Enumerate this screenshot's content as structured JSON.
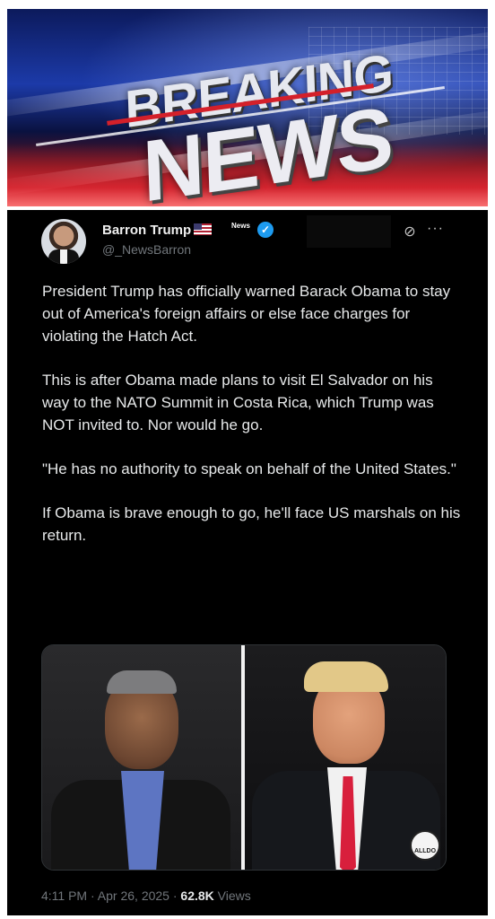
{
  "banner": {
    "line1": "BREAKING",
    "line2": "NEWS"
  },
  "tweet": {
    "author_name": "Barron Trump",
    "badge_text": "News",
    "verified_mark": "✓",
    "handle": "@_NewsBarron",
    "paragraphs": [
      "President Trump has officially warned Barack Obama to stay out of America's foreign affairs or else face charges for violating the Hatch Act.",
      "This is after Obama made plans to visit El Salvador on his way to the NATO Summit in Costa Rica, which Trump was NOT invited to. Nor would he go.",
      "\"He has no authority to speak on behalf of the United States.\"",
      "If Obama is brave enough to go, he'll face US marshals on his return."
    ],
    "media": {
      "watermark": "ALLDO"
    },
    "time": "4:11 PM",
    "separator": "·",
    "date": "Apr 26, 2025",
    "views_count": "62.8K",
    "views_label": "Views"
  },
  "icons": {
    "grok": "grok-icon",
    "more": "more-icon",
    "verified": "verified-badge-icon",
    "flag": "us-flag-icon"
  },
  "colors": {
    "background": "#000000",
    "text": "#e7e9ea",
    "secondary_text": "#71767b",
    "verified": "#1d9bf0"
  }
}
